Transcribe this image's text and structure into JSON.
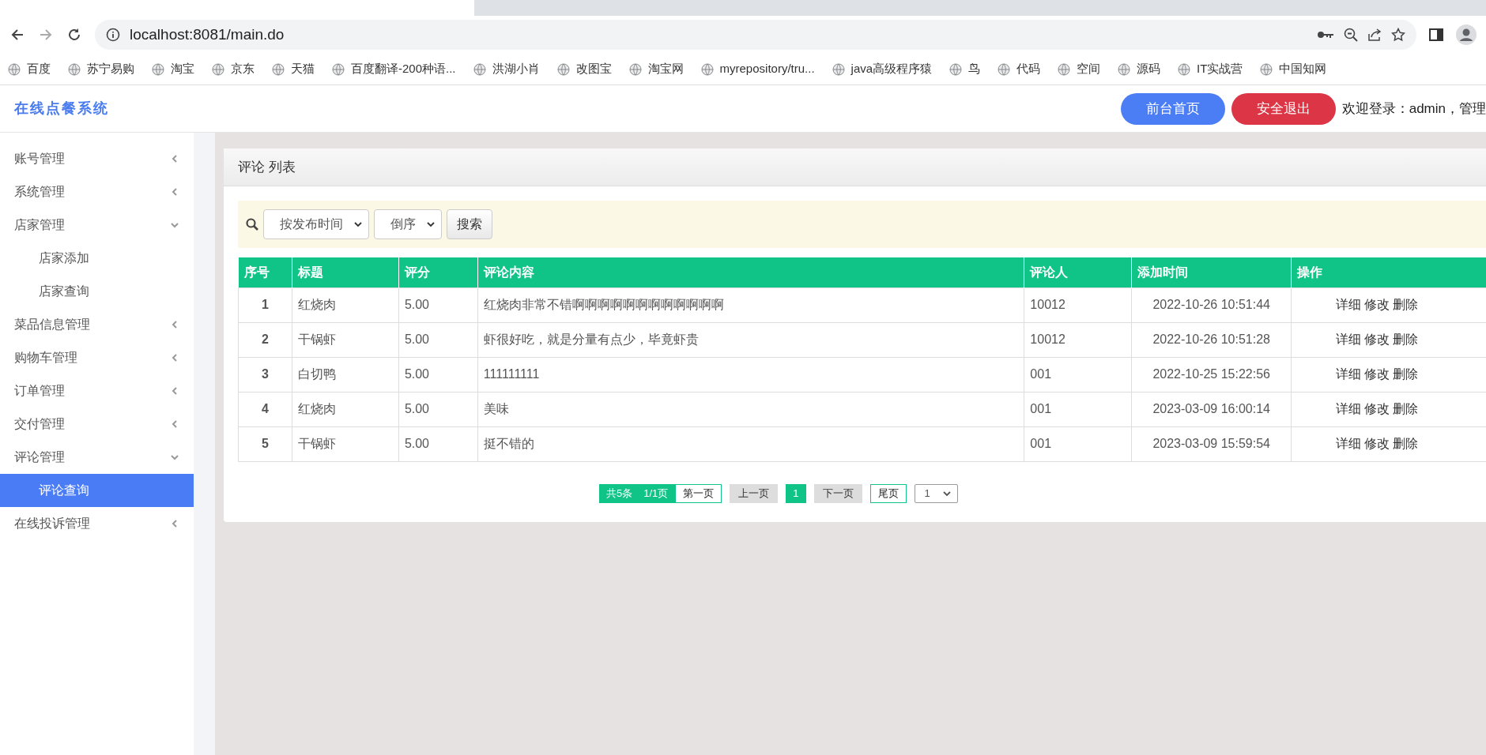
{
  "browser": {
    "address": "localhost:8081/main.do",
    "bookmarks": [
      "百度",
      "苏宁易购",
      "淘宝",
      "京东",
      "天猫",
      "百度翻译-200种语...",
      "洪湖小肖",
      "改图宝",
      "淘宝网",
      "myrepository/tru...",
      "java高级程序猿",
      "鸟",
      "代码",
      "空间",
      "源码",
      "IT实战营",
      "中国知网"
    ]
  },
  "header": {
    "logo": "在线点餐系统",
    "buttons": [
      {
        "label": "前台首页",
        "kind": "primary"
      },
      {
        "label": "安全退出",
        "kind": "danger"
      }
    ],
    "welcome": "欢迎登录：admin，管理"
  },
  "sidebar": {
    "items": [
      {
        "label": "账号管理",
        "expanded": false
      },
      {
        "label": "系统管理",
        "expanded": false
      },
      {
        "label": "店家管理",
        "expanded": true,
        "children": [
          {
            "label": "店家添加",
            "selected": false
          },
          {
            "label": "店家查询",
            "selected": false
          }
        ]
      },
      {
        "label": "菜品信息管理",
        "expanded": false
      },
      {
        "label": "购物车管理",
        "expanded": false
      },
      {
        "label": "订单管理",
        "expanded": false
      },
      {
        "label": "交付管理",
        "expanded": false
      },
      {
        "label": "评论管理",
        "expanded": true,
        "children": [
          {
            "label": "评论查询",
            "selected": true
          }
        ]
      },
      {
        "label": "在线投诉管理",
        "expanded": false
      }
    ]
  },
  "panel": {
    "title": "评论 列表",
    "filter": {
      "sort_field": "按发布时间",
      "order": "倒序",
      "search_button": "搜索"
    },
    "table": {
      "columns": [
        "序号",
        "标题",
        "评分",
        "评论内容",
        "评论人",
        "添加时间",
        "操作"
      ],
      "rows": [
        {
          "cells": [
            "1",
            "红烧肉",
            "5.00",
            "红烧肉非常不错啊啊啊啊啊啊啊啊啊啊啊啊",
            "10012",
            "2022-10-26 10:51:44"
          ],
          "actions": [
            "详细",
            "修改",
            "删除"
          ]
        },
        {
          "cells": [
            "2",
            "干锅虾",
            "5.00",
            "虾很好吃，就是分量有点少，毕竟虾贵",
            "10012",
            "2022-10-26 10:51:28"
          ],
          "actions": [
            "详细",
            "修改",
            "删除"
          ]
        },
        {
          "cells": [
            "3",
            "白切鸭",
            "5.00",
            "111111111",
            "001",
            "2022-10-25 15:22:56"
          ],
          "actions": [
            "详细",
            "修改",
            "删除"
          ]
        },
        {
          "cells": [
            "4",
            "红烧肉",
            "5.00",
            "美味",
            "001",
            "2023-03-09 16:00:14"
          ],
          "actions": [
            "详细",
            "修改",
            "删除"
          ]
        },
        {
          "cells": [
            "5",
            "干锅虾",
            "5.00",
            "挺不错的",
            "001",
            "2023-03-09 15:59:54"
          ],
          "actions": [
            "详细",
            "修改",
            "删除"
          ]
        }
      ]
    },
    "pagination": {
      "total": "共5条",
      "pages": "1/1页",
      "first": "第一页",
      "prev": "上一页",
      "page_buttons": [
        {
          "label": "1",
          "selected": true
        }
      ],
      "next": "下一页",
      "last": "尾页",
      "jump": "1"
    }
  }
}
